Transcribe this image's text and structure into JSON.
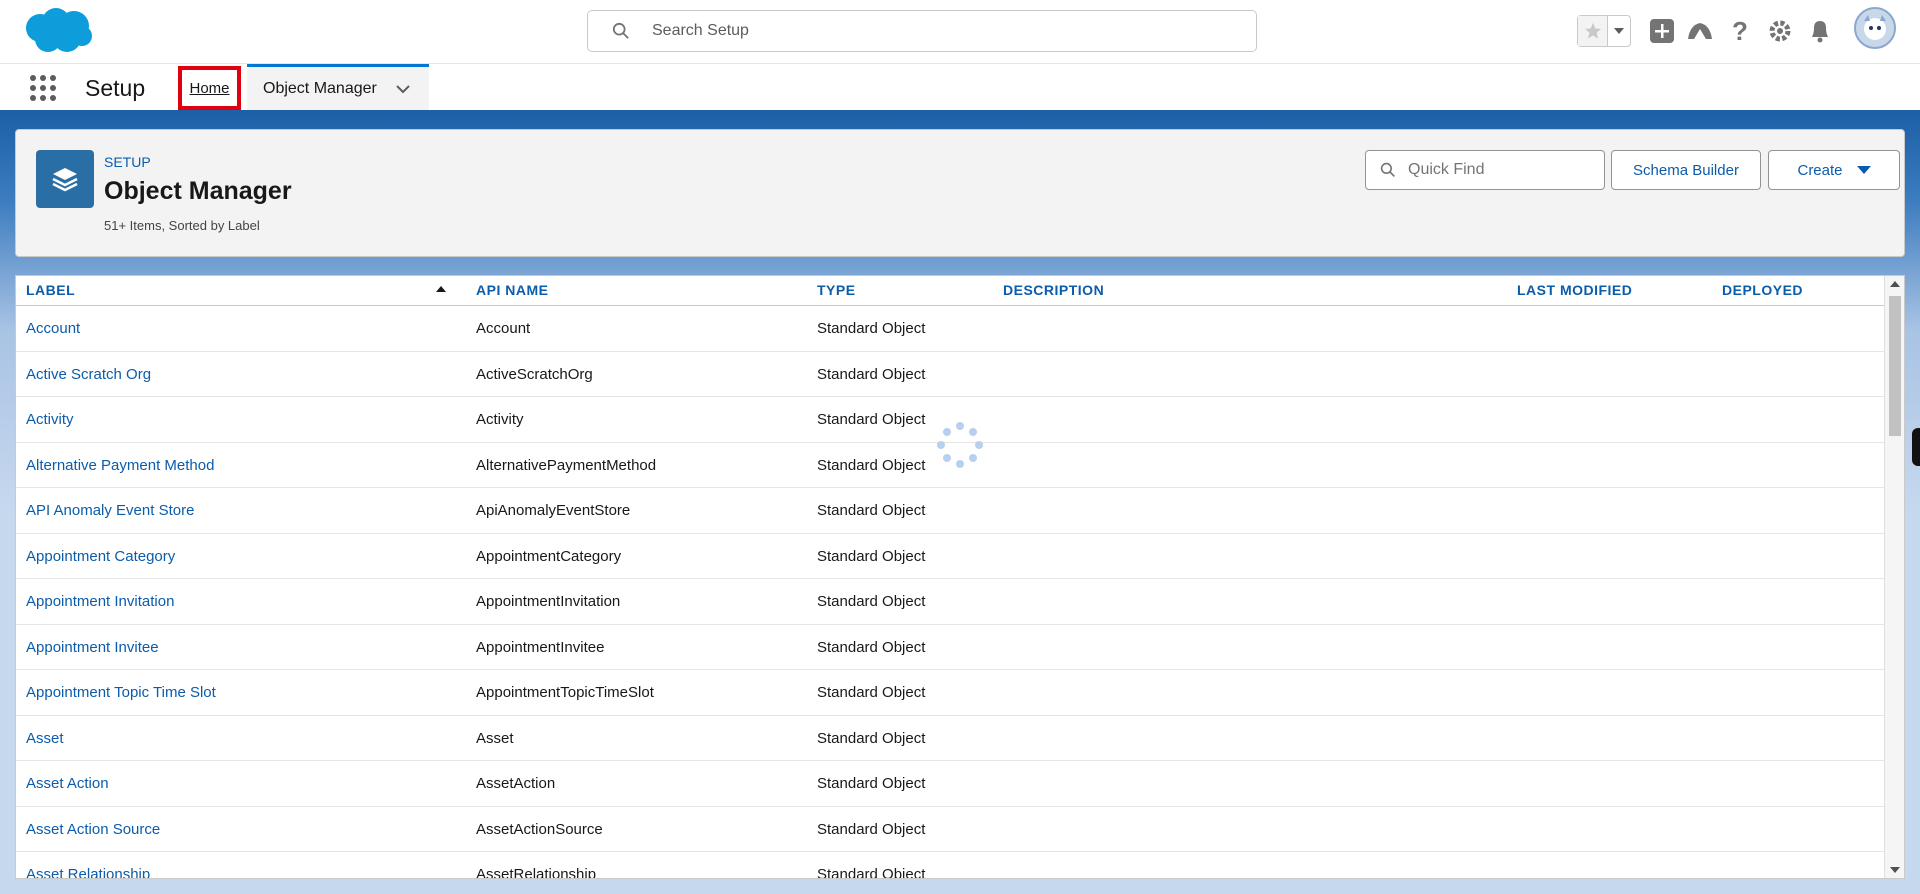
{
  "header": {
    "search_placeholder": "Search Setup",
    "icons": [
      "favorites-star-icon",
      "favorites-dropdown-icon",
      "global-actions-plus-icon",
      "trailhead-icon",
      "help-icon",
      "setup-gear-icon",
      "notifications-bell-icon",
      "user-avatar"
    ]
  },
  "context_bar": {
    "app_name": "Setup",
    "tabs": [
      {
        "label": "Home"
      },
      {
        "label": "Object Manager"
      }
    ]
  },
  "page_header": {
    "eyebrow": "SETUP",
    "title": "Object Manager",
    "subtitle": "51+ Items, Sorted by Label",
    "quick_find_placeholder": "Quick Find",
    "schema_builder_label": "Schema Builder",
    "create_label": "Create"
  },
  "table": {
    "columns": [
      "LABEL",
      "API NAME",
      "TYPE",
      "DESCRIPTION",
      "LAST MODIFIED",
      "DEPLOYED"
    ],
    "rows": [
      {
        "label": "Account",
        "api": "Account",
        "type": "Standard Object"
      },
      {
        "label": "Active Scratch Org",
        "api": "ActiveScratchOrg",
        "type": "Standard Object"
      },
      {
        "label": "Activity",
        "api": "Activity",
        "type": "Standard Object"
      },
      {
        "label": "Alternative Payment Method",
        "api": "AlternativePaymentMethod",
        "type": "Standard Object"
      },
      {
        "label": "API Anomaly Event Store",
        "api": "ApiAnomalyEventStore",
        "type": "Standard Object"
      },
      {
        "label": "Appointment Category",
        "api": "AppointmentCategory",
        "type": "Standard Object"
      },
      {
        "label": "Appointment Invitation",
        "api": "AppointmentInvitation",
        "type": "Standard Object"
      },
      {
        "label": "Appointment Invitee",
        "api": "AppointmentInvitee",
        "type": "Standard Object"
      },
      {
        "label": "Appointment Topic Time Slot",
        "api": "AppointmentTopicTimeSlot",
        "type": "Standard Object"
      },
      {
        "label": "Asset",
        "api": "Asset",
        "type": "Standard Object"
      },
      {
        "label": "Asset Action",
        "api": "AssetAction",
        "type": "Standard Object"
      },
      {
        "label": "Asset Action Source",
        "api": "AssetActionSource",
        "type": "Standard Object"
      },
      {
        "label": "Asset Relationship",
        "api": "AssetRelationship",
        "type": "Standard Object"
      }
    ]
  },
  "colors": {
    "brand_blue": "#0176d3",
    "link_blue": "#0b5cab",
    "highlight_red": "#e0000f"
  }
}
